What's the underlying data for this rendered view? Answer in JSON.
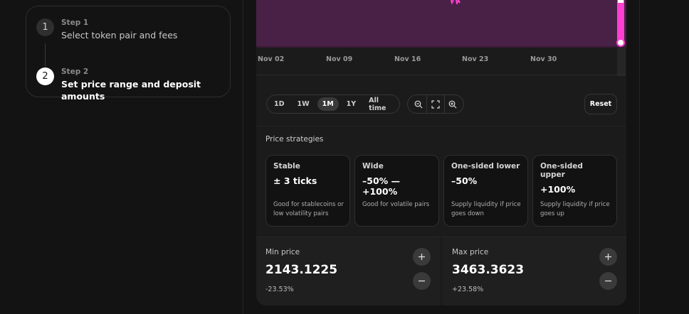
{
  "stepper": {
    "steps": [
      {
        "number": "1",
        "label": "Step 1",
        "title": "Select token pair and fees"
      },
      {
        "number": "2",
        "label": "Step 2",
        "title": "Set price range and deposit amounts"
      }
    ]
  },
  "chart": {
    "area_color": "#4a2146",
    "handle_color": "#ff3fd2",
    "x_ticks": [
      "Nov 02",
      "Nov 09",
      "Nov 16",
      "Nov 23",
      "Nov 30"
    ]
  },
  "range_buttons": [
    "1D",
    "1W",
    "1M",
    "1Y",
    "All time"
  ],
  "range_selected": "1M",
  "zoom_icons": [
    "zoom-out-icon",
    "fullscreen-icon",
    "zoom-in-icon"
  ],
  "reset_label": "Reset",
  "strategies": {
    "title": "Price strategies",
    "items": [
      {
        "title": "Stable",
        "value": "± 3 ticks",
        "desc": "Good for stablecoins or low volatility pairs"
      },
      {
        "title": "Wide",
        "value": "–50% — +100%",
        "desc": "Good for volatile pairs"
      },
      {
        "title": "One-sided lower",
        "value": "–50%",
        "desc": "Supply liquidity if price goes down"
      },
      {
        "title": "One-sided upper",
        "value": "+100%",
        "desc": "Supply liquidity if price goes up"
      }
    ]
  },
  "min_price": {
    "label": "Min price",
    "value": "2143.1225",
    "pct": "-23.53%"
  },
  "max_price": {
    "label": "Max price",
    "value": "3463.3623",
    "pct": "+23.58%"
  }
}
